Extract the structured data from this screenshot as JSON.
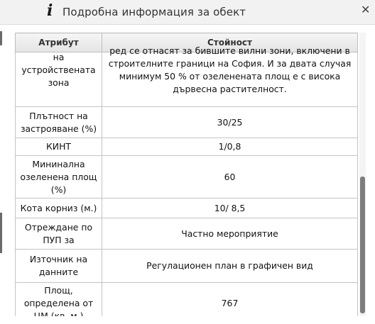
{
  "window": {
    "title": "Подробна информация за обект",
    "info_icon": "info-icon",
    "close_icon": "close-icon"
  },
  "table": {
    "headers": {
      "attribute": "Атрибут",
      "value": "Стойност"
    },
    "rows": [
      {
        "attribute": "на устройствената зона",
        "value": "ред се отнасят за бившите вилни зони, включени в строителните граници на София. И за двата случая минимум 50 % от озеленената площ е с висока дървесна растителност."
      },
      {
        "attribute": "Плътност на застрояване (%)",
        "value": "30/25"
      },
      {
        "attribute": "КИНТ",
        "value": "1/0,8"
      },
      {
        "attribute": "Мининална озеленена площ (%)",
        "value": "60"
      },
      {
        "attribute": "Кота корниз (м.)",
        "value": "10/ 8,5"
      },
      {
        "attribute": "Отреждане по ПУП за",
        "value": "Частно мероприятие"
      },
      {
        "attribute": "Източник на данните",
        "value": "Регулационен план в графичен вид"
      },
      {
        "attribute": "Площ, определена от ЦМ (кв. м.)",
        "value": "767"
      }
    ]
  }
}
